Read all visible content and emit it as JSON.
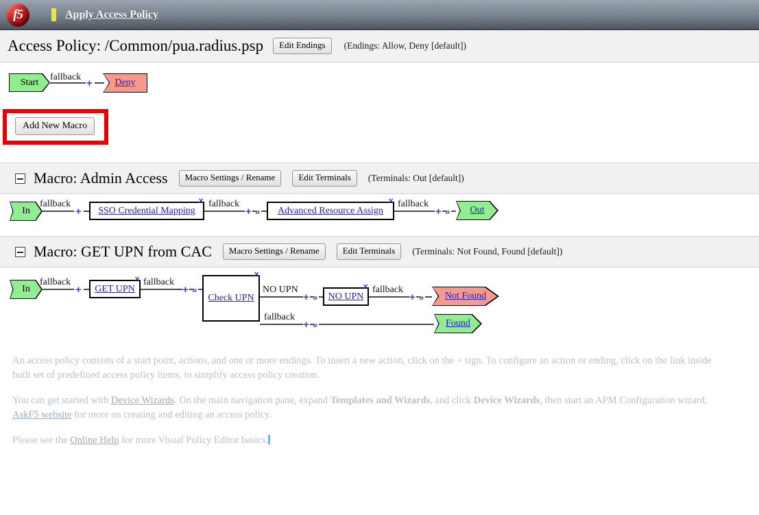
{
  "topbar": {
    "logo_alt": "f5",
    "apply_link": "Apply Access Policy"
  },
  "policy_header": {
    "title": "Access Policy: /Common/pua.radius.psp",
    "edit_endings_label": "Edit Endings",
    "endings_note": "(Endings: Allow, Deny [default])"
  },
  "main_flow": {
    "start_label": "Start",
    "branch_label": "fallback",
    "plus": "+",
    "deny_label": "Deny"
  },
  "add_macro": {
    "label": "Add New Macro"
  },
  "macros": [
    {
      "title": "Macro: Admin Access",
      "settings_label": "Macro Settings / Rename",
      "terminals_label": "Edit Terminals",
      "terminals_note": "(Terminals: Out [default])",
      "in_label": "In",
      "branch1": "fallback",
      "action1": "SSO Credential Mapping",
      "branch2": "fallback",
      "action2": "Advanced Resource Assign",
      "branch3": "fallback",
      "out_label": "Out",
      "plus": "+",
      "arrow": "»",
      "close": "×"
    },
    {
      "title": "Macro: GET UPN from CAC",
      "settings_label": "Macro Settings / Rename",
      "terminals_label": "Edit Terminals",
      "terminals_note": "(Terminals: Not Found, Found [default])",
      "in_label": "In",
      "branch1": "fallback",
      "action1": "GET UPN",
      "branch2": "fallback",
      "action2": "Check UPN",
      "branch_top": "NO UPN",
      "branch_bottom": "fallback",
      "action3": "NO UPN",
      "branch3": "fallback",
      "term_not_found": "Not Found",
      "term_found": "Found",
      "plus": "+",
      "arrow": "»",
      "close": "×"
    }
  ],
  "footer": {
    "p1_a": "An access policy consists of a start point, actions, and one or more endings. To insert a new action, click on the + sign. To configure an action or ending, click on the link inside",
    "p1_b": "built set of predefined access policy items, to simplify access policy creation.",
    "p2_a": "You can get started with ",
    "p2_link1": "Device Wizards",
    "p2_b": ". On the main navigation pane, expand ",
    "p2_bold1": "Templates and Wizards",
    "p2_c": ", and click ",
    "p2_bold2": "Device Wizards",
    "p2_d": ", then start an APM Configuration wizard,",
    "p2_link2": "AskF5 website",
    "p2_e": " for more on creating and editing an access policy.",
    "p3_a": "Please see the ",
    "p3_link": "Online Help",
    "p3_b": " for more Visual Policy Editor basics."
  },
  "colors": {
    "terminal_green": "#90ee90",
    "terminal_red": "#f79a8e",
    "link_blue": "#2020c0",
    "highlight_red": "#ee0000",
    "accent_yellow": "#e8e83a"
  }
}
